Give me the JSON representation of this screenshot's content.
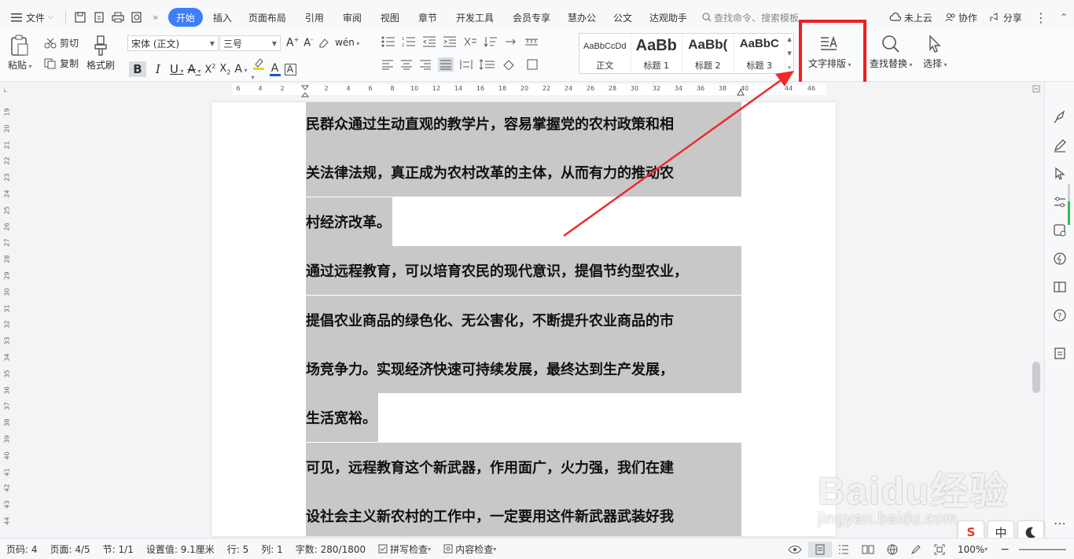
{
  "menubar": {
    "file_label": "文件",
    "tabs": [
      "开始",
      "插入",
      "页面布局",
      "引用",
      "审阅",
      "视图",
      "章节",
      "开发工具",
      "会员专享",
      "慧办公",
      "公文",
      "达观助手"
    ],
    "active_tab": "开始",
    "search_label": "查找命令、搜索模板",
    "cloud_label": "未上云",
    "collab_label": "协作",
    "share_label": "分享"
  },
  "ribbon": {
    "paste_label": "粘贴",
    "cut_label": "剪切",
    "copy_label": "复制",
    "format_painter_label": "格式刷",
    "font_name": "宋体 (正文)",
    "font_size": "三号",
    "styles": [
      {
        "preview": "AaBbCcDd",
        "label": "正文"
      },
      {
        "preview": "AaBb",
        "label": "标题 1"
      },
      {
        "preview": "AaBb(",
        "label": "标题 2"
      },
      {
        "preview": "AaBbC",
        "label": "标题 3"
      }
    ],
    "text_layout_label": "文字排版",
    "find_replace_label": "查找替换",
    "select_label": "选择"
  },
  "ruler": {
    "h_ticks": [
      "6",
      "4",
      "2",
      "",
      "2",
      "4",
      "6",
      "8",
      "10",
      "12",
      "14",
      "16",
      "18",
      "20",
      "22",
      "24",
      "26",
      "28",
      "30",
      "32",
      "34",
      "36",
      "38",
      "40",
      "44",
      "46"
    ],
    "v_ticks": [
      "19",
      "20",
      "21",
      "22",
      "23",
      "24",
      "25",
      "26",
      "27",
      "28",
      "29",
      "30",
      "31",
      "32",
      "33",
      "34",
      "35",
      "36",
      "37",
      "38",
      "39",
      "40",
      "41",
      "42",
      "43",
      "44"
    ]
  },
  "document": {
    "lines": [
      {
        "text": "民群众通过生动直观的教学片，容易掌握党的农村政策和相",
        "full": true
      },
      {
        "text": "关法律法规，真正成为农村改革的主体，从而有力的推动农",
        "full": true
      },
      {
        "text": "村经济改革。",
        "full": false
      },
      {
        "text": "通过远程教育，可以培育农民的现代意识，提倡节约型农业，",
        "full": true
      },
      {
        "text": "提倡农业商品的绿色化、无公害化，不断提升农业商品的市",
        "full": true
      },
      {
        "text": "场竞争力。实现经济快速可持续发展，最终达到生产发展，",
        "full": true
      },
      {
        "text": "生活宽裕。",
        "full": false
      },
      {
        "text": "可见，远程教育这个新武器，作用面广，火力强，我们在建",
        "full": true
      },
      {
        "text": "设社会主义新农村的工作中，一定要用这件新武器武装好我",
        "full": true
      }
    ]
  },
  "statusbar": {
    "page_num": "页码: 4",
    "pages": "页面: 4/5",
    "section": "节: 1/1",
    "setting": "设置值: 9.1厘米",
    "row": "行: 5",
    "col": "列: 1",
    "word_count": "字数: 280/1800",
    "spell_check": "拼写检查",
    "content_check": "内容检查",
    "zoom": "100%"
  },
  "watermark": {
    "brand": "Baidu经验",
    "url": "jingyan.baidu.com"
  },
  "ime": {
    "mode": "中"
  },
  "colors": {
    "accent": "#3e7ef6",
    "highlight": "#ef1f1f",
    "selection": "#c8c8c8"
  }
}
